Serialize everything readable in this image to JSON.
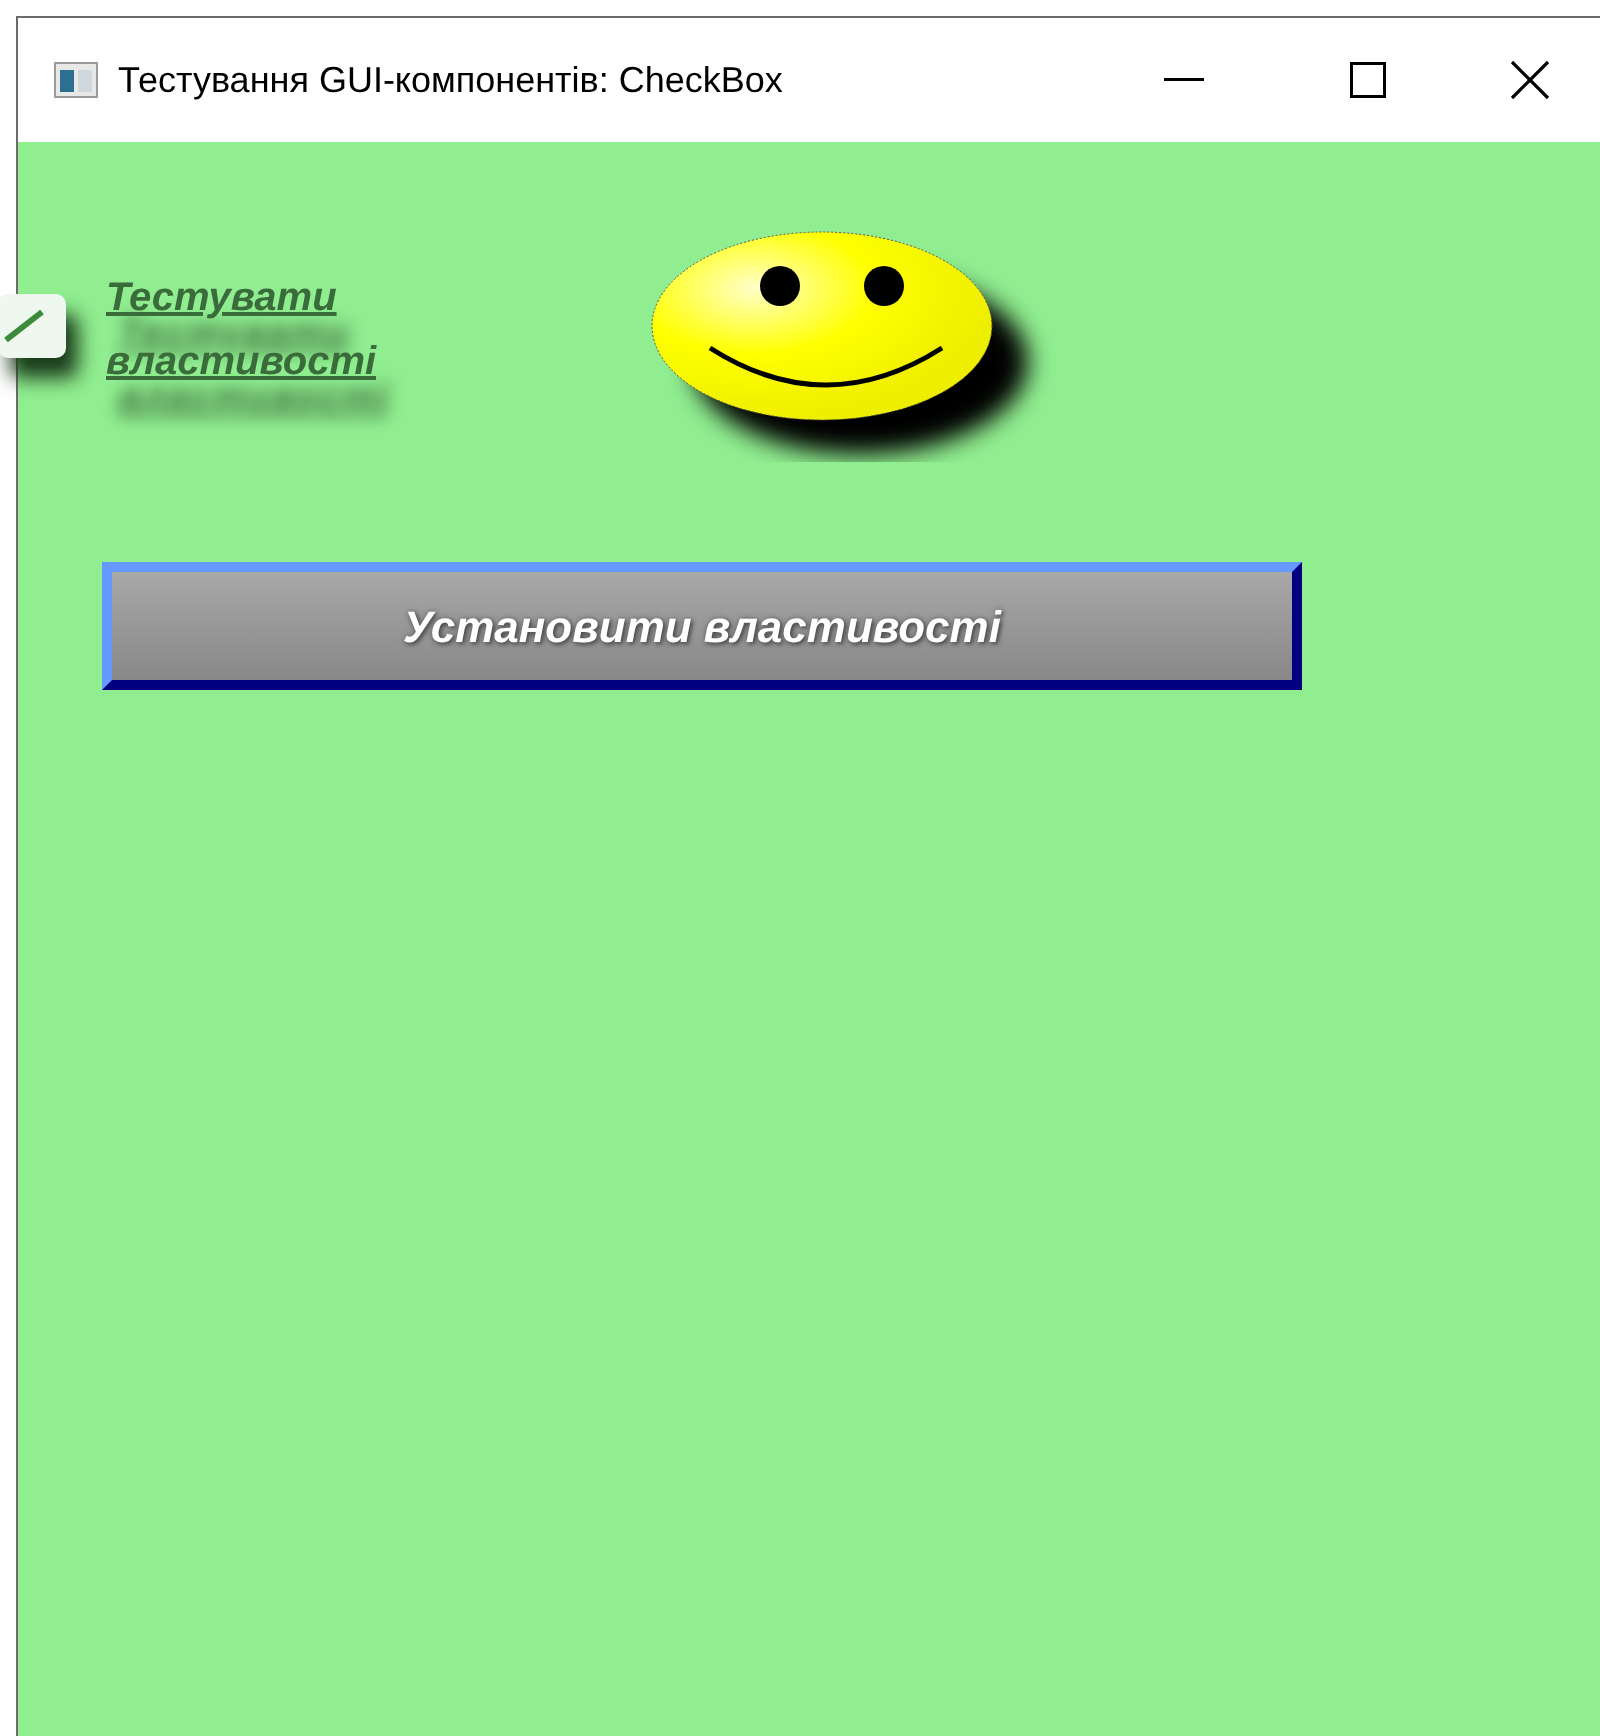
{
  "window": {
    "title": "Тестування GUI-компонентів: CheckBox"
  },
  "checkbox": {
    "label": "Тестувати властивості",
    "checked": true
  },
  "button": {
    "label": "Установити властивості"
  }
}
